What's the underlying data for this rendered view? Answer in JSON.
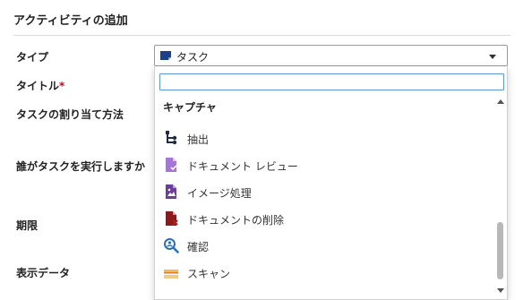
{
  "dialog": {
    "title": "アクティビティの追加"
  },
  "fields": {
    "type_label": "タイプ",
    "title_label": "タイトル",
    "required_mark": "*",
    "assign_method_label": "タスクの割り当て方法",
    "who_label": "誰がタスクを実行しますか",
    "due_label": "期限",
    "display_data_label": "表示データ"
  },
  "type_select": {
    "selected": "タスク",
    "icon": "task-icon"
  },
  "dropdown": {
    "search_value": "",
    "group_header": "キャプチャ",
    "items": [
      {
        "label": "抽出",
        "icon": "extract-icon",
        "color": "#1f2a44"
      },
      {
        "label": "ドキュメント レビュー",
        "icon": "document-review-icon",
        "color": "#9b59d0"
      },
      {
        "label": "イメージ処理",
        "icon": "image-processing-icon",
        "color": "#6a3d9a"
      },
      {
        "label": "ドキュメントの削除",
        "icon": "document-delete-icon",
        "color": "#8b1a1a"
      },
      {
        "label": "確認",
        "icon": "verify-icon",
        "color": "#2f6fb0"
      },
      {
        "label": "スキャン",
        "icon": "scan-icon",
        "color": "#e8a33c"
      }
    ]
  }
}
